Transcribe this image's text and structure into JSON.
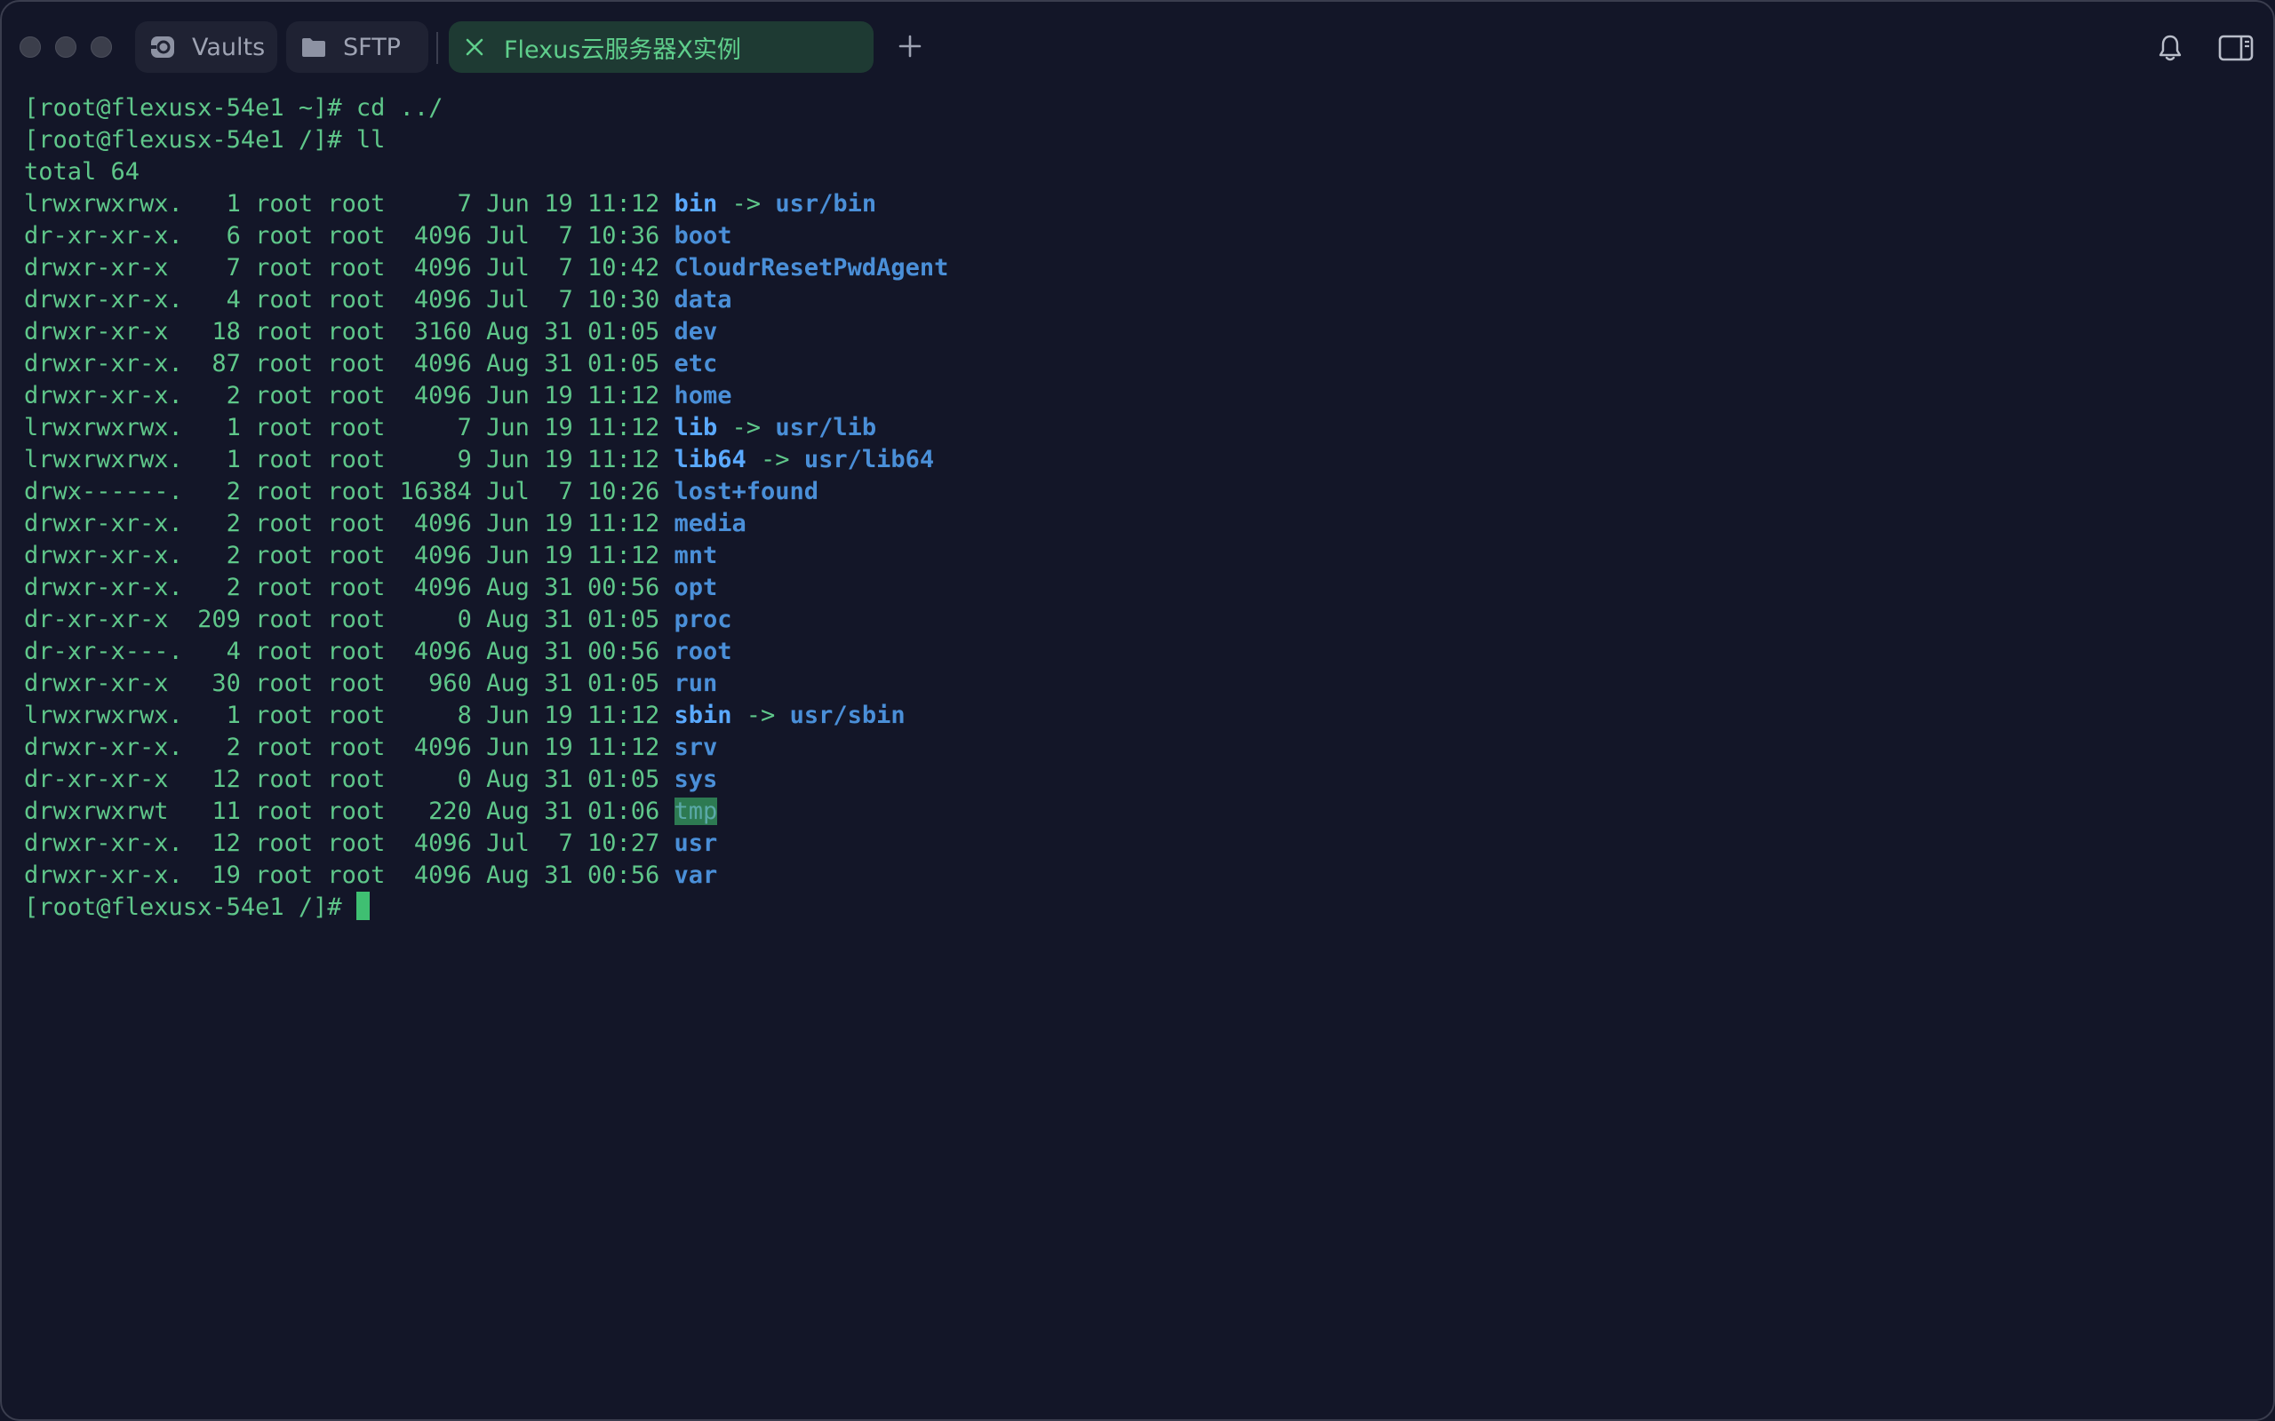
{
  "tabs": [
    {
      "label": "Vaults",
      "icon": "vault-icon"
    },
    {
      "label": "SFTP",
      "icon": "folder-icon"
    },
    {
      "label": "Flexus云服务器X实例",
      "icon": "close-icon"
    }
  ],
  "toolbar": {
    "new_tab_icon": "plus-icon",
    "notifications_icon": "bell-icon",
    "sidebar_icon": "sidebar-toggle-icon"
  },
  "terminal": {
    "prompt": "[root@flexusx-54e1 /]# ",
    "lines": [
      {
        "text": "[root@flexusx-54e1 ~]# cd ../"
      },
      {
        "text": "[root@flexusx-54e1 /]# ll"
      },
      {
        "text": "total 64"
      }
    ],
    "entries": [
      {
        "meta": "lrwxrwxrwx.   1 root root     7 Jun 19 11:12 ",
        "name": "bin",
        "target": "usr/bin",
        "type": "link"
      },
      {
        "meta": "dr-xr-xr-x.   6 root root  4096 Jul  7 10:36 ",
        "name": "boot",
        "type": "dir"
      },
      {
        "meta": "drwxr-xr-x    7 root root  4096 Jul  7 10:42 ",
        "name": "CloudrResetPwdAgent",
        "type": "dir"
      },
      {
        "meta": "drwxr-xr-x.   4 root root  4096 Jul  7 10:30 ",
        "name": "data",
        "type": "dir"
      },
      {
        "meta": "drwxr-xr-x   18 root root  3160 Aug 31 01:05 ",
        "name": "dev",
        "type": "dir"
      },
      {
        "meta": "drwxr-xr-x.  87 root root  4096 Aug 31 01:05 ",
        "name": "etc",
        "type": "dir"
      },
      {
        "meta": "drwxr-xr-x.   2 root root  4096 Jun 19 11:12 ",
        "name": "home",
        "type": "dir"
      },
      {
        "meta": "lrwxrwxrwx.   1 root root     7 Jun 19 11:12 ",
        "name": "lib",
        "target": "usr/lib",
        "type": "link"
      },
      {
        "meta": "lrwxrwxrwx.   1 root root     9 Jun 19 11:12 ",
        "name": "lib64",
        "target": "usr/lib64",
        "type": "link"
      },
      {
        "meta": "drwx------.   2 root root 16384 Jul  7 10:26 ",
        "name": "lost+found",
        "type": "dir"
      },
      {
        "meta": "drwxr-xr-x.   2 root root  4096 Jun 19 11:12 ",
        "name": "media",
        "type": "dir"
      },
      {
        "meta": "drwxr-xr-x.   2 root root  4096 Jun 19 11:12 ",
        "name": "mnt",
        "type": "dir"
      },
      {
        "meta": "drwxr-xr-x.   2 root root  4096 Aug 31 00:56 ",
        "name": "opt",
        "type": "dir"
      },
      {
        "meta": "dr-xr-xr-x  209 root root     0 Aug 31 01:05 ",
        "name": "proc",
        "type": "dir"
      },
      {
        "meta": "dr-xr-x---.   4 root root  4096 Aug 31 00:56 ",
        "name": "root",
        "type": "dir"
      },
      {
        "meta": "drwxr-xr-x   30 root root   960 Aug 31 01:05 ",
        "name": "run",
        "type": "dir"
      },
      {
        "meta": "lrwxrwxrwx.   1 root root     8 Jun 19 11:12 ",
        "name": "sbin",
        "target": "usr/sbin",
        "type": "link"
      },
      {
        "meta": "drwxr-xr-x.   2 root root  4096 Jun 19 11:12 ",
        "name": "srv",
        "type": "dir"
      },
      {
        "meta": "dr-xr-xr-x   12 root root     0 Aug 31 01:05 ",
        "name": "sys",
        "type": "dir"
      },
      {
        "meta": "drwxrwxrwt   11 root root   220 Aug 31 01:06 ",
        "name": "tmp",
        "type": "sticky"
      },
      {
        "meta": "drwxr-xr-x.  12 root root  4096 Jul  7 10:27 ",
        "name": "usr",
        "type": "dir"
      },
      {
        "meta": "drwxr-xr-x.  19 root root  4096 Aug 31 00:56 ",
        "name": "var",
        "type": "dir"
      }
    ],
    "link_arrow": " -> "
  },
  "colors": {
    "background": "#131628",
    "text_green": "#5fc78a",
    "dir_blue": "#4a8fd8",
    "link_blue": "#5aa9ff",
    "active_tab": "#1e3a33",
    "cursor": "#3fbf72"
  }
}
